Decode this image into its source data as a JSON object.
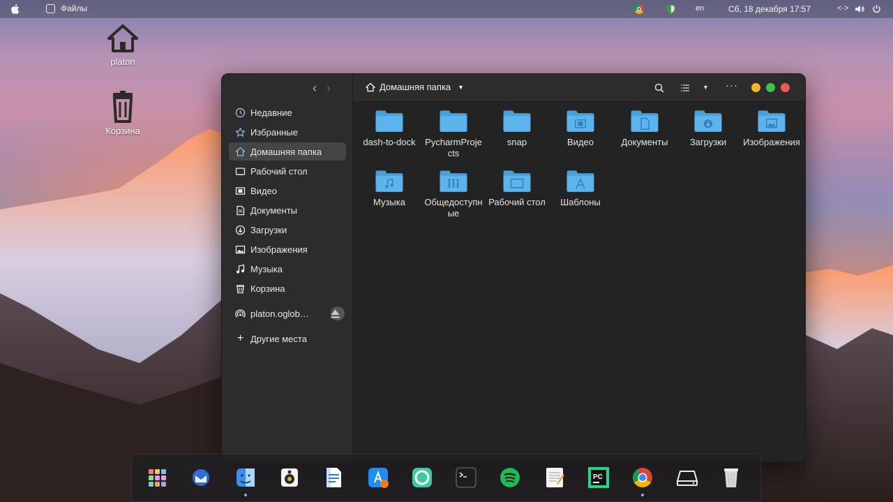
{
  "topbar": {
    "app_name": "Файлы",
    "lang": "en",
    "datetime": "Сб, 18 декабря  17:57",
    "network_glyph": "<·>"
  },
  "desktop": {
    "home_label": "platon",
    "trash_label": "Корзина"
  },
  "window": {
    "breadcrumb": "Домашняя папка",
    "sidebar": {
      "items": [
        {
          "label": "Недавние",
          "icon": "clock-icon"
        },
        {
          "label": "Избранные",
          "icon": "star-icon"
        },
        {
          "label": "Домашняя папка",
          "icon": "home-icon",
          "active": true
        },
        {
          "label": "Рабочий стол",
          "icon": "desktop-icon"
        },
        {
          "label": "Видео",
          "icon": "video-icon"
        },
        {
          "label": "Документы",
          "icon": "document-icon"
        },
        {
          "label": "Загрузки",
          "icon": "download-icon"
        },
        {
          "label": "Изображения",
          "icon": "image-icon"
        },
        {
          "label": "Музыка",
          "icon": "music-icon"
        },
        {
          "label": "Корзина",
          "icon": "trash-icon"
        }
      ],
      "network_mount": "platon.oglob…",
      "other_places": "Другие места"
    },
    "files": [
      {
        "name": "dash-to-dock",
        "emblem": ""
      },
      {
        "name": "PycharmProjects",
        "emblem": ""
      },
      {
        "name": "snap",
        "emblem": ""
      },
      {
        "name": "Видео",
        "emblem": "video"
      },
      {
        "name": "Документы",
        "emblem": "document"
      },
      {
        "name": "Загрузки",
        "emblem": "download"
      },
      {
        "name": "Изображения",
        "emblem": "image"
      },
      {
        "name": "Музыка",
        "emblem": "music"
      },
      {
        "name": "Общедоступные",
        "emblem": "public"
      },
      {
        "name": "Рабочий стол",
        "emblem": "desktop"
      },
      {
        "name": "Шаблоны",
        "emblem": "template"
      }
    ]
  },
  "dock": {
    "items": [
      {
        "name": "launchpad-icon",
        "color": "#e8e8e8"
      },
      {
        "name": "thunderbird-icon",
        "color": "#f5f5f5"
      },
      {
        "name": "finder-icon",
        "color": "#3b8fe8",
        "running": true
      },
      {
        "name": "rhythmbox-icon",
        "color": "#f6f6f6"
      },
      {
        "name": "libreoffice-writer-icon",
        "color": "#f2f2f2"
      },
      {
        "name": "software-center-icon",
        "color": "#1f8ef0"
      },
      {
        "name": "lifebuoy-icon",
        "color": "#3cc9a3"
      },
      {
        "name": "terminal-icon",
        "color": "#1d1d1d"
      },
      {
        "name": "spotify-icon",
        "color": "#1db954"
      },
      {
        "name": "text-editor-icon",
        "color": "#f0f0f0"
      },
      {
        "name": "pycharm-icon",
        "color": "#111111"
      },
      {
        "name": "chrome-icon",
        "color": "#ffffff",
        "running": true
      },
      {
        "name": "drive-icon",
        "color": "#dddddd"
      },
      {
        "name": "trash-icon",
        "color": "#d9d9d9"
      }
    ]
  },
  "colors": {
    "folder": "#5db3ec",
    "folder_dark": "#4a9fd9",
    "close": "#ee5a52",
    "minimize": "#f4b61d",
    "maximize": "#3cc34c"
  }
}
